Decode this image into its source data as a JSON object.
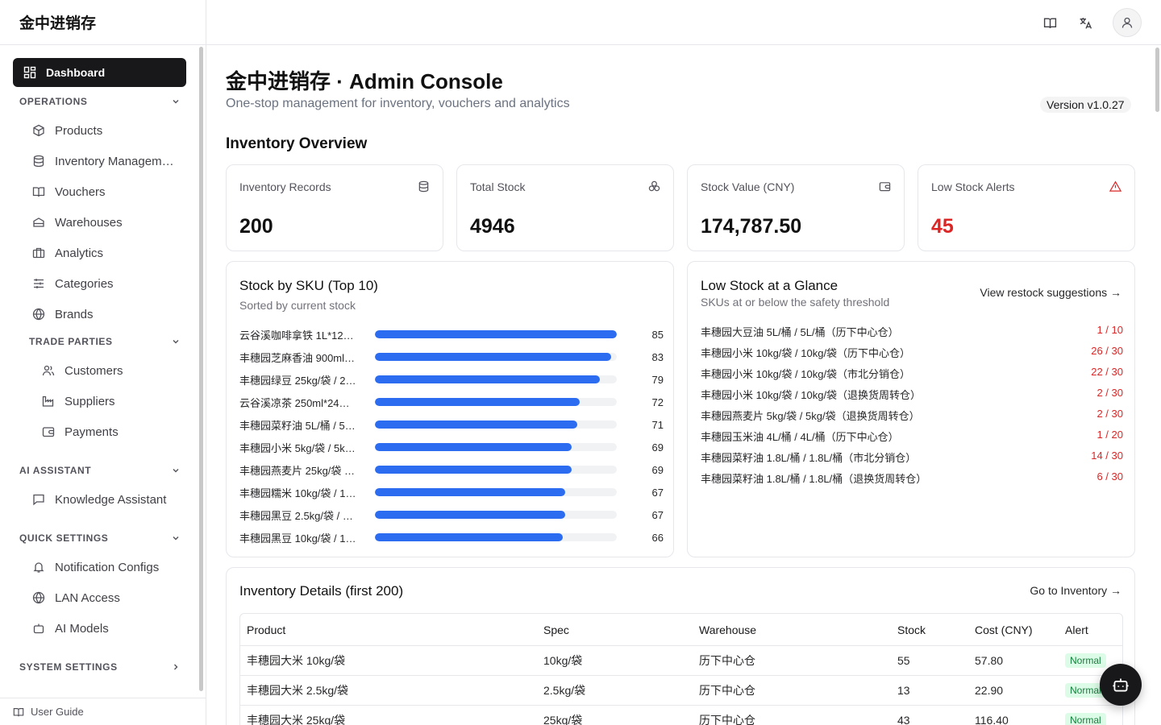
{
  "app": {
    "brand": "金中进销存"
  },
  "sidebar": {
    "active_item": "Dashboard",
    "groups": {
      "operations": "OPERATIONS",
      "trade_parties": "TRADE PARTIES",
      "ai_assistant": "AI ASSISTANT",
      "quick_settings": "QUICK SETTINGS",
      "system_settings": "SYSTEM SETTINGS"
    },
    "items": {
      "products": "Products",
      "inventory": "Inventory Managem…",
      "vouchers": "Vouchers",
      "warehouses": "Warehouses",
      "analytics": "Analytics",
      "categories": "Categories",
      "brands": "Brands",
      "customers": "Customers",
      "suppliers": "Suppliers",
      "payments": "Payments",
      "knowledge": "Knowledge Assistant",
      "notification": "Notification Configs",
      "lan": "LAN Access",
      "ai_models": "AI Models"
    },
    "footer": "User Guide"
  },
  "header": {
    "title": "金中进销存 · Admin Console",
    "subtitle": "One-stop management for inventory, vouchers and analytics",
    "version": "Version v1.0.27"
  },
  "overview": {
    "title": "Inventory Overview",
    "stats": [
      {
        "label": "Inventory Records",
        "value": "200",
        "icon": "database-icon"
      },
      {
        "label": "Total Stock",
        "value": "4946",
        "icon": "boxes-icon"
      },
      {
        "label": "Stock Value (CNY)",
        "value": "174,787.50",
        "icon": "wallet-icon"
      },
      {
        "label": "Low Stock Alerts",
        "value": "45",
        "icon": "alert-triangle-icon"
      }
    ]
  },
  "sku_chart": {
    "title": "Stock by SKU (Top 10)",
    "subtitle": "Sorted by current stock",
    "max": 85
  },
  "chart_data": {
    "type": "bar",
    "categories": [
      "云谷溪咖啡拿铁 1L*12…",
      "丰穗园芝麻香油 900ml…",
      "丰穗园绿豆 25kg/袋 / 2…",
      "云谷溪凉茶 250ml*24…",
      "丰穗园菜籽油 5L/桶 / 5…",
      "丰穗园小米 5kg/袋 / 5k…",
      "丰穗园燕麦片 25kg/袋 …",
      "丰穗园糯米 10kg/袋 / 1…",
      "丰穗园黑豆 2.5kg/袋 / …",
      "丰穗园黑豆 10kg/袋 / 1…"
    ],
    "values": [
      85,
      83,
      79,
      72,
      71,
      69,
      69,
      67,
      67,
      66
    ],
    "title": "Stock by SKU (Top 10)"
  },
  "low_stock": {
    "title": "Low Stock at a Glance",
    "subtitle": "SKUs at or below the safety threshold",
    "link": "View restock suggestions →",
    "rows": [
      {
        "name": "丰穗园大豆油 5L/桶 / 5L/桶（历下中心仓）",
        "value": "1 / 10"
      },
      {
        "name": "丰穗园小米 10kg/袋 / 10kg/袋（历下中心仓）",
        "value": "26 / 30"
      },
      {
        "name": "丰穗园小米 10kg/袋 / 10kg/袋（市北分销仓）",
        "value": "22 / 30"
      },
      {
        "name": "丰穗园小米 10kg/袋 / 10kg/袋（退换货周转仓）",
        "value": "2 / 30"
      },
      {
        "name": "丰穗园燕麦片 5kg/袋 / 5kg/袋（退换货周转仓）",
        "value": "2 / 30"
      },
      {
        "name": "丰穗园玉米油 4L/桶 / 4L/桶（历下中心仓）",
        "value": "1 / 20"
      },
      {
        "name": "丰穗园菜籽油 1.8L/桶 / 1.8L/桶（市北分销仓）",
        "value": "14 / 30"
      },
      {
        "name": "丰穗园菜籽油 1.8L/桶 / 1.8L/桶（退换货周转仓）",
        "value": "6 / 30"
      }
    ]
  },
  "details": {
    "title": "Inventory Details (first 200)",
    "link": "Go to Inventory →",
    "columns": [
      "Product",
      "Spec",
      "Warehouse",
      "Stock",
      "Cost (CNY)",
      "Alert"
    ],
    "rows": [
      [
        "丰穗园大米 10kg/袋",
        "10kg/袋",
        "历下中心仓",
        "55",
        "57.80",
        "Normal"
      ],
      [
        "丰穗园大米 2.5kg/袋",
        "2.5kg/袋",
        "历下中心仓",
        "13",
        "22.90",
        "Normal"
      ],
      [
        "丰穗园大米 25kg/袋",
        "25kg/袋",
        "历下中心仓",
        "43",
        "116.40",
        "Normal"
      ]
    ]
  },
  "colors": {
    "bar": "#2b6cf0",
    "alert": "#dc2626",
    "active_nav": "#18181b"
  }
}
